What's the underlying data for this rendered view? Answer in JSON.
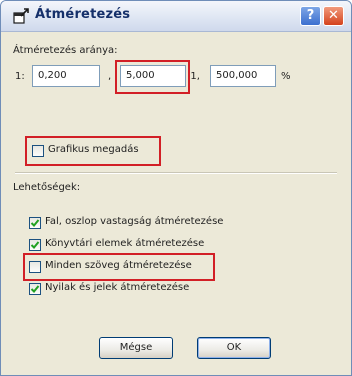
{
  "window": {
    "title": "Átméretezés",
    "help_label": "?",
    "close_label": "✕"
  },
  "ratio": {
    "section_label": "Átméretezés aránya:",
    "prefix": "1:",
    "value1": "0,200",
    "sep1": ",",
    "value2": "5,000",
    "sep2": ":1,",
    "value3": "500,000",
    "unit": "%"
  },
  "graphical": {
    "label": "Grafikus megadás",
    "checked": false
  },
  "options": {
    "section_label": "Lehetőségek:",
    "items": [
      {
        "label": "Fal, oszlop vastagság átméretezése",
        "checked": true
      },
      {
        "label": "Könyvtári elemek átméretezése",
        "checked": true
      },
      {
        "label": "Minden szöveg átméretezése",
        "checked": false
      },
      {
        "label": "Nyilak és jelek átméretezése",
        "checked": true
      }
    ]
  },
  "buttons": {
    "cancel": "Mégse",
    "ok": "OK"
  },
  "colors": {
    "highlight": "#d21f26",
    "check": "#21a121"
  }
}
